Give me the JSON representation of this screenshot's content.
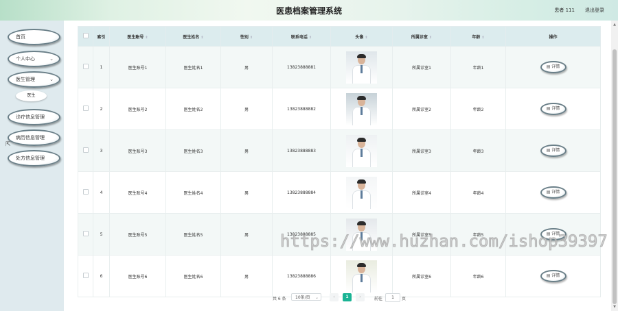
{
  "header": {
    "title": "医患档案管理系统",
    "user": "患者 111",
    "logout": "退出登录"
  },
  "sidebar": {
    "items": [
      {
        "label": "首页",
        "chevron": ""
      },
      {
        "label": "个人中心",
        "chevron": "⌄"
      },
      {
        "label": "医生管理",
        "chevron": "⌄"
      },
      {
        "label": "诊疗信息管理",
        "chevron": ""
      },
      {
        "label": "病历信息管理",
        "chevron": ""
      },
      {
        "label": "处方信息管理",
        "chevron": ""
      }
    ],
    "sub_item": "医生"
  },
  "table": {
    "headers": [
      "索引",
      "医生账号",
      "医生姓名",
      "性别",
      "联系电话",
      "头像",
      "所属诊室",
      "年龄",
      "操作"
    ],
    "sort_icon": "⇕",
    "rows": [
      {
        "index": "1",
        "account": "医生账号1",
        "name": "医生姓名1",
        "gender": "男",
        "phone": "13823888881",
        "room": "所属诊室1",
        "age": "年龄1"
      },
      {
        "index": "2",
        "account": "医生账号2",
        "name": "医生姓名2",
        "gender": "男",
        "phone": "13823888882",
        "room": "所属诊室2",
        "age": "年龄2"
      },
      {
        "index": "3",
        "account": "医生账号3",
        "name": "医生姓名3",
        "gender": "男",
        "phone": "13823888883",
        "room": "所属诊室3",
        "age": "年龄3"
      },
      {
        "index": "4",
        "account": "医生账号4",
        "name": "医生姓名4",
        "gender": "男",
        "phone": "13823888884",
        "room": "所属诊室4",
        "age": "年龄4"
      },
      {
        "index": "5",
        "account": "医生账号5",
        "name": "医生姓名5",
        "gender": "男",
        "phone": "13823888885",
        "room": "所属诊室5",
        "age": "年龄5"
      },
      {
        "index": "6",
        "account": "医生账号6",
        "name": "医生姓名6",
        "gender": "男",
        "phone": "13823888886",
        "room": "所属诊室6",
        "age": "年龄6"
      }
    ],
    "detail_label": "▤ 详情"
  },
  "pager": {
    "total": "共 6 条",
    "page_size": "10条/页",
    "prev": "‹",
    "current": "1",
    "next": "›",
    "goto_prefix": "前往",
    "goto_value": "1",
    "goto_suffix": "页"
  },
  "watermark": "https://www.huzhan.com/ishop39397",
  "colors": {
    "accent": "#1ab394",
    "header_row": "#dcecee",
    "sidebar_bg": "#dfeaee"
  }
}
